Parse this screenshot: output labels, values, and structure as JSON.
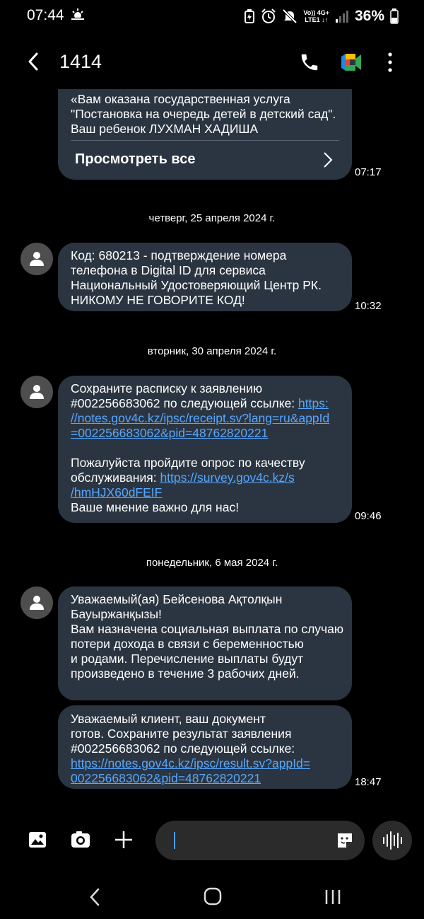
{
  "status_bar": {
    "time": "07:44",
    "net_top": "Vo)) 4G+",
    "net_bottom": "LTE1 ↓↑",
    "battery": "36%"
  },
  "header": {
    "title": "1414"
  },
  "messages": [
    {
      "lines": [
        "«Вам оказана государственная услуга",
        "\"Постановка на очередь детей в детский сад\".",
        "Ваш ребенок ЛУХМАН ХАДИША"
      ],
      "view_all": "Просмотреть все",
      "time": "07:17"
    },
    {
      "date": "четверг, 25 апреля 2024 г.",
      "lines": [
        "Код: 680213 - подтверждение номера",
        "телефона в Digital ID для сервиса",
        "Национальный Удостоверяющий Центр РК.",
        "НИКОМУ НЕ ГОВОРИТЕ КОД!"
      ],
      "time": "10:32"
    },
    {
      "date": "вторник, 30 апреля 2024 г.",
      "l1": "Сохраните расписку к заявлению",
      "l2a": "#002256683062 по следующей ссылке: ",
      "l2link": "https:",
      "l3link": "//notes.gov4c.kz/ipsc/receipt.sv?lang=ru&appId",
      "l4link": "=002256683062&pid=48762820221",
      "l5": "Пожалуйста пройдите опрос по качеству",
      "l6a": "обслуживания: ",
      "l6link": "https://survey.gov4c.kz/s",
      "l7link": "/hmHJX60dFEIF",
      "l8": "Ваше мнение важно для нас!",
      "time": "09:46"
    },
    {
      "date": "понедельник, 6 мая 2024 г.",
      "lines": [
        "Уважаемый(ая) Бейсенова Ақтолқын",
        "Бауыржанқызы!",
        "Вам назначена социальная выплата по случаю",
        "потери дохода в связи с беременностью",
        "и родами. Перечисление выплаты будут",
        "произведено в течение 3 рабочих дней."
      ]
    },
    {
      "l1": "Уважаемый клиент, ваш документ",
      "l2": "готов. Сохраните результат заявления",
      "l3": "#002256683062 по следующей ссылке:",
      "l4link": "https://notes.gov4c.kz/ipsc/result.sv?appId=",
      "l5link": "002256683062&pid=48762820221",
      "time": "18:47"
    }
  ],
  "composer": {
    "placeholder": ""
  }
}
